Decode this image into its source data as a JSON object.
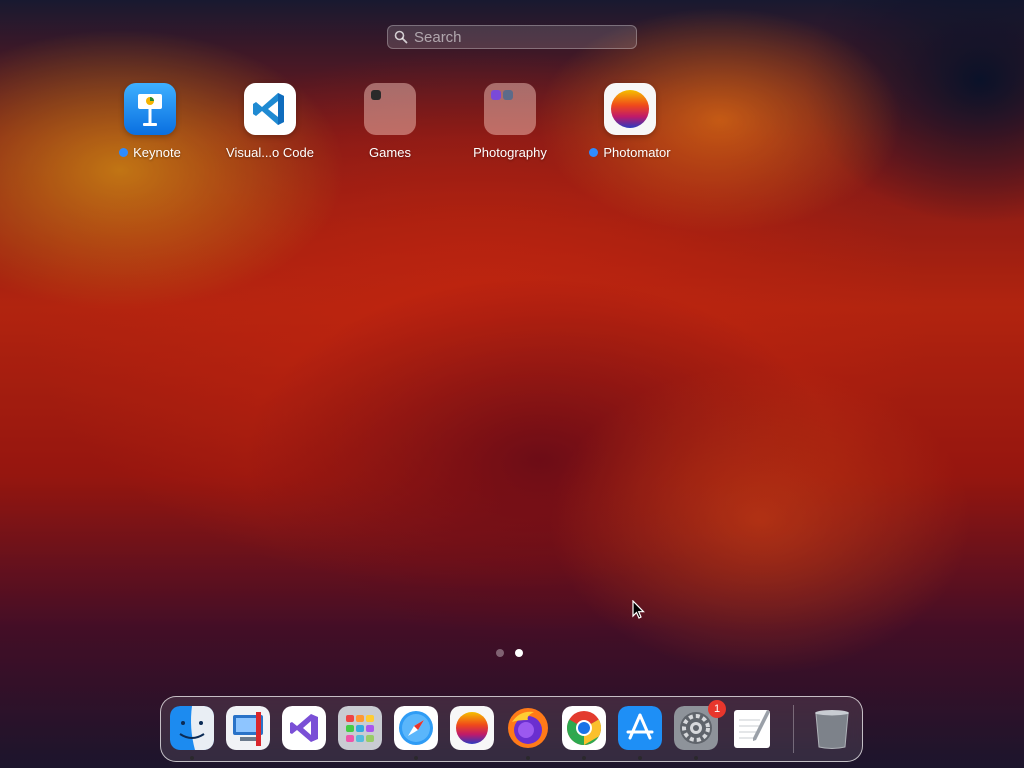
{
  "search": {
    "placeholder": "Search"
  },
  "apps": [
    {
      "label": "Keynote",
      "icon": "keynote-icon",
      "new": true
    },
    {
      "label": "Visual...o Code",
      "icon": "vscode-icon",
      "new": false
    },
    {
      "label": "Games",
      "icon": "folder-icon",
      "new": false
    },
    {
      "label": "Photography",
      "icon": "folder-icon",
      "new": false
    },
    {
      "label": "Photomator",
      "icon": "photomator-icon",
      "new": true
    }
  ],
  "pages": {
    "count": 2,
    "current": 2
  },
  "dock": {
    "items": [
      {
        "icon": "finder-icon",
        "running": true
      },
      {
        "icon": "remote-desktop-icon",
        "running": false
      },
      {
        "icon": "visual-studio-icon",
        "running": false
      },
      {
        "icon": "launchpad-icon",
        "running": false
      },
      {
        "icon": "safari-icon",
        "running": true
      },
      {
        "icon": "photomator-icon",
        "running": false
      },
      {
        "icon": "firefox-icon",
        "running": true
      },
      {
        "icon": "chrome-icon",
        "running": true
      },
      {
        "icon": "app-store-icon",
        "running": true
      },
      {
        "icon": "system-settings-icon",
        "running": true,
        "badge": "1"
      },
      {
        "icon": "textedit-icon",
        "running": false
      },
      {
        "icon": "trash-icon",
        "running": false
      }
    ]
  },
  "colors": {
    "new_dot": "#2f8cff",
    "badge": "#e8362c"
  }
}
